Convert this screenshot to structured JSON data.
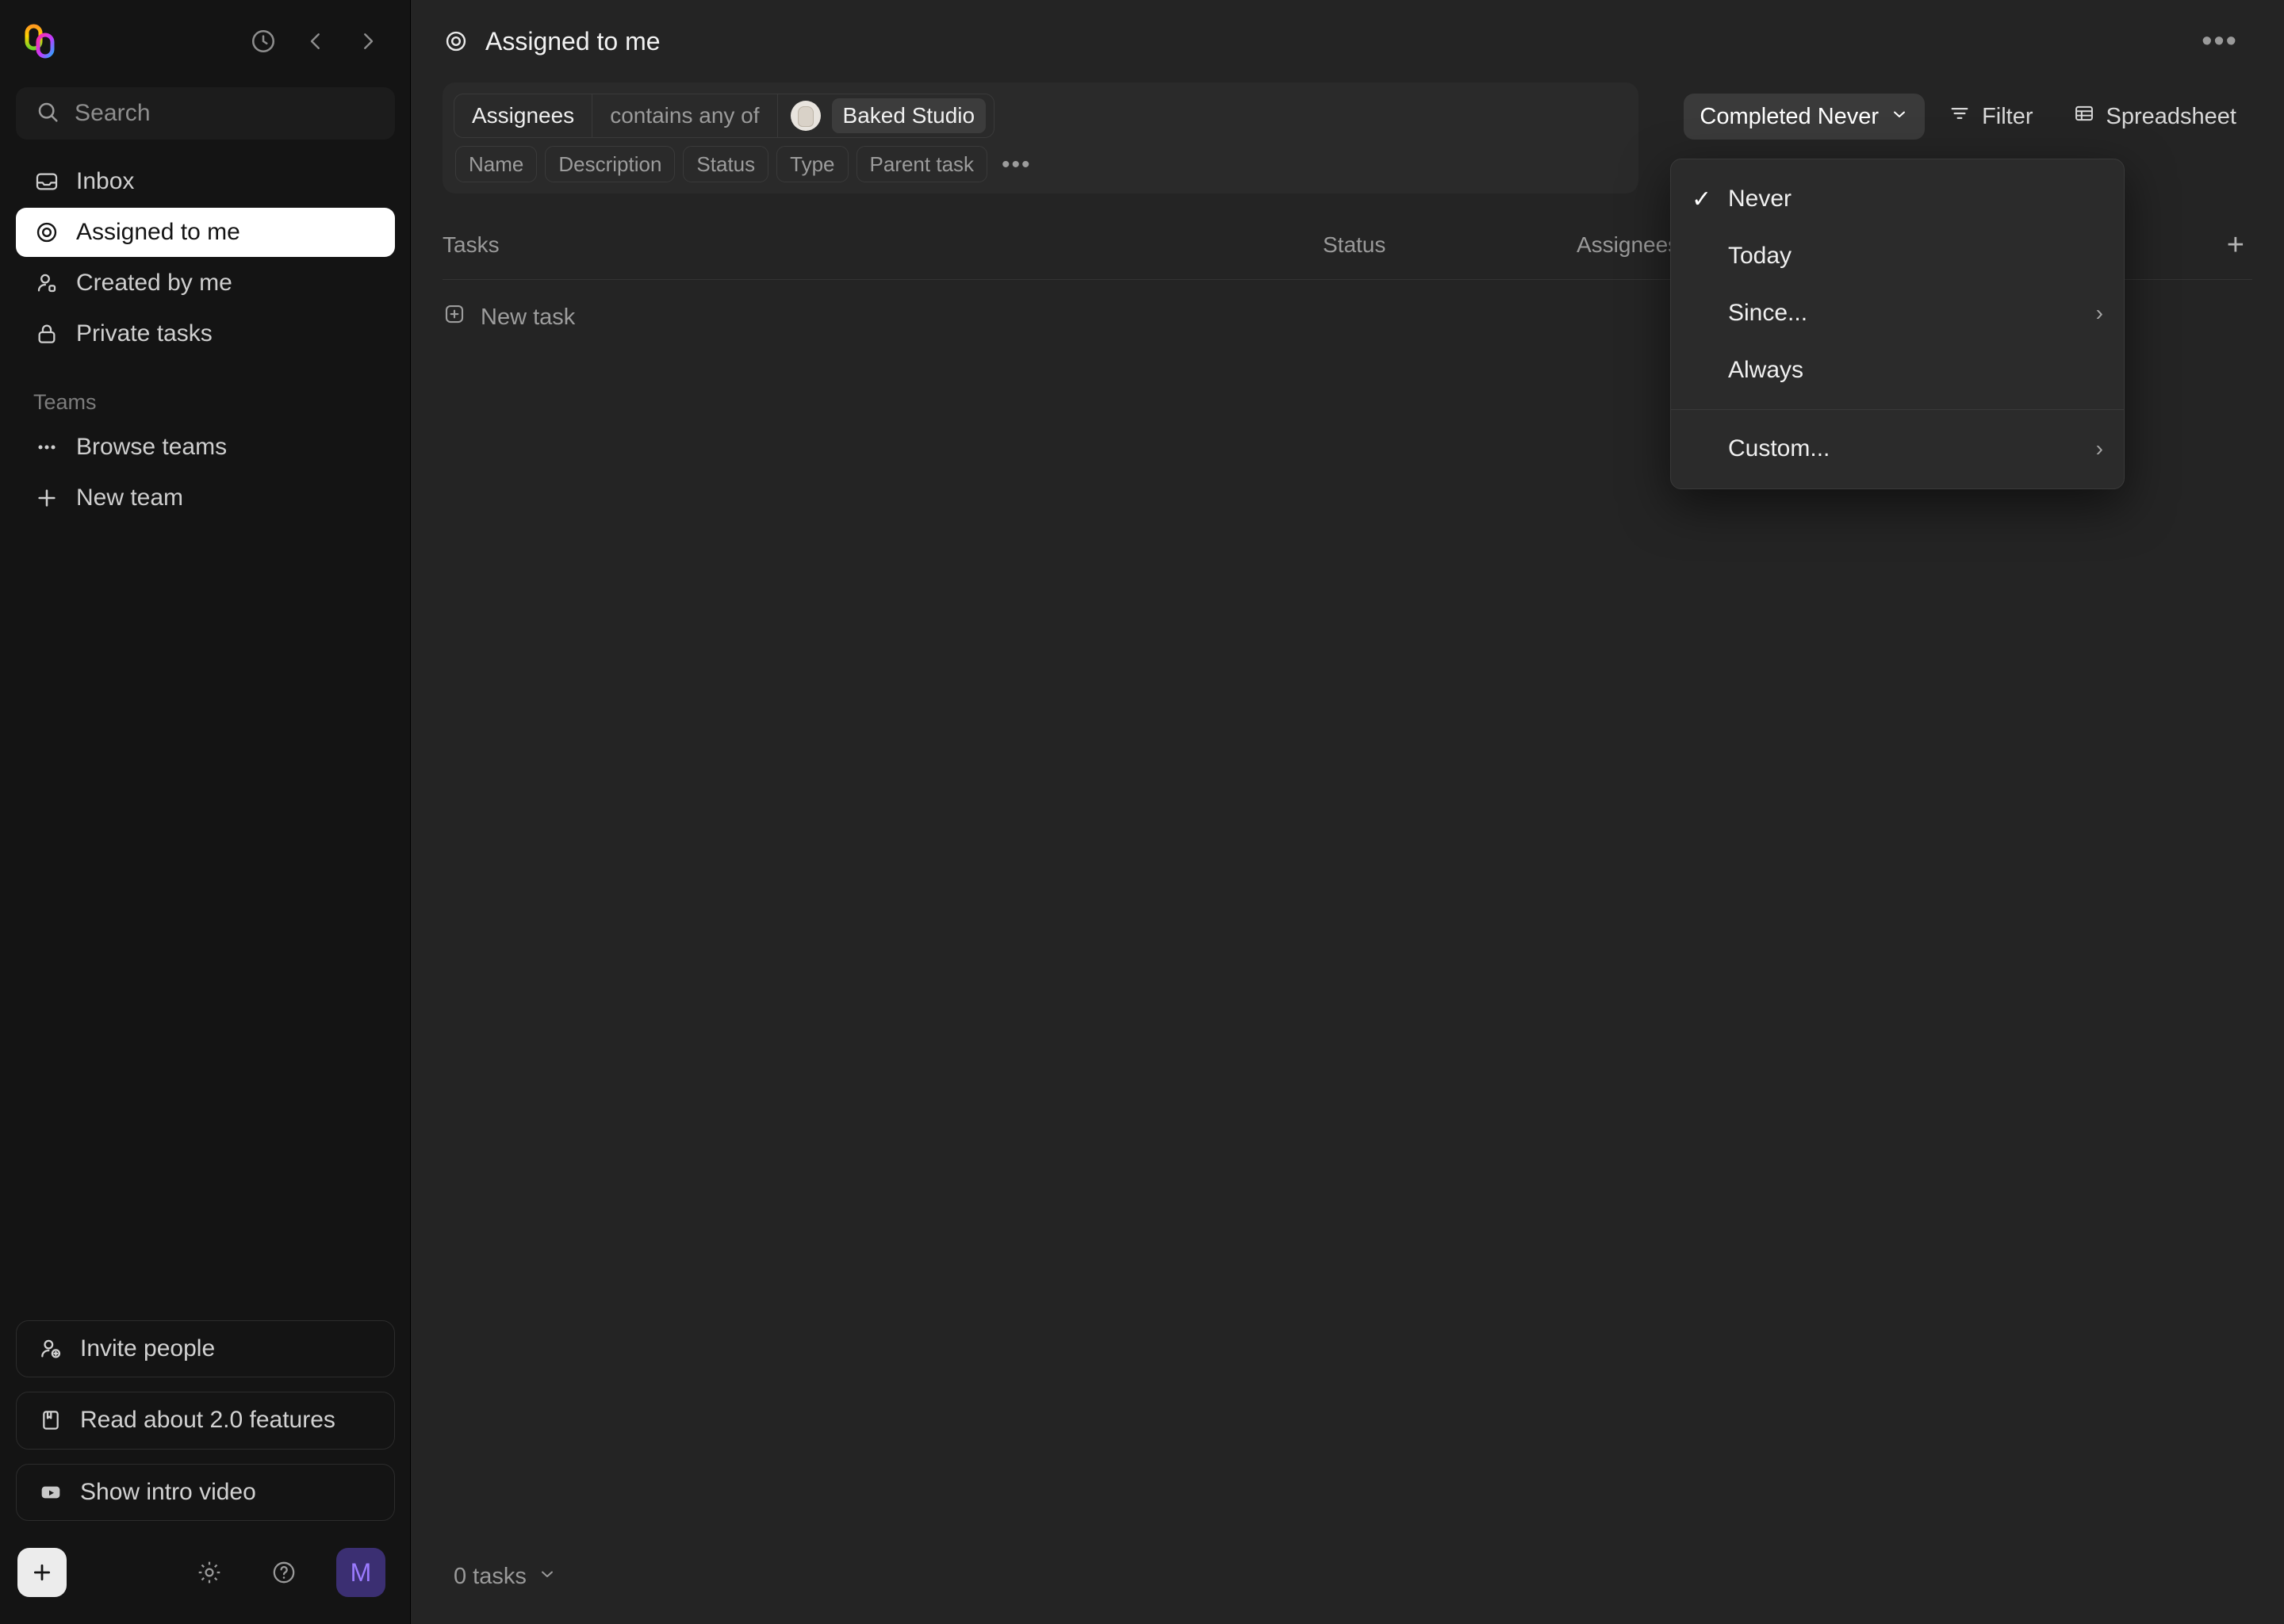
{
  "app": {
    "logo_name": "height-logo",
    "accent_purple": "#9b7bff",
    "avatar_bg": "#3b2f72"
  },
  "sidebar": {
    "history_icon": "clock-icon",
    "back_icon": "chevron-left-icon",
    "forward_icon": "chevron-right-icon",
    "search": {
      "placeholder": "Search",
      "icon": "search-icon"
    },
    "nav_items": [
      {
        "label": "Inbox",
        "icon": "inbox-icon",
        "active": false
      },
      {
        "label": "Assigned to me",
        "icon": "target-icon",
        "active": true
      },
      {
        "label": "Created by me",
        "icon": "user-icon",
        "active": false
      },
      {
        "label": "Private tasks",
        "icon": "lock-icon",
        "active": false
      }
    ],
    "teams_section_label": "Teams",
    "team_items": [
      {
        "label": "Browse teams",
        "icon": "ellipsis-icon"
      },
      {
        "label": "New team",
        "icon": "plus-icon"
      }
    ],
    "cards": [
      {
        "label": "Invite people",
        "icon": "user-plus-icon"
      },
      {
        "label": "Read about 2.0 features",
        "icon": "book-icon"
      },
      {
        "label": "Show intro video",
        "icon": "video-play-icon"
      }
    ],
    "bottom": {
      "new_label": "+",
      "settings_icon": "gear-icon",
      "help_icon": "question-circle-icon",
      "avatar_initial": "M"
    }
  },
  "header": {
    "title": "Assigned to me",
    "title_icon": "target-icon",
    "more_label": "•••"
  },
  "filters": {
    "pill": {
      "field": "Assignees",
      "operator": "contains any of",
      "value": "Baked Studio",
      "avatar_name": "baked-studio-avatar"
    },
    "chips": [
      "Name",
      "Description",
      "Status",
      "Type",
      "Parent task"
    ],
    "chips_more": "•••"
  },
  "toolbar": {
    "completed_label": "Completed Never",
    "completed_caret": "⌄",
    "filter_label": "Filter",
    "filter_icon": "filter-icon",
    "spreadsheet_label": "Spreadsheet",
    "spreadsheet_icon": "table-icon"
  },
  "dropdown": {
    "items": [
      {
        "label": "Never",
        "checked": true,
        "submenu": false
      },
      {
        "label": "Today",
        "checked": false,
        "submenu": false
      },
      {
        "label": "Since...",
        "checked": false,
        "submenu": true
      },
      {
        "label": "Always",
        "checked": false,
        "submenu": false
      }
    ],
    "custom": {
      "label": "Custom...",
      "submenu": true
    },
    "check_glyph": "✓",
    "arrow_glyph": "›"
  },
  "table": {
    "columns": [
      "Tasks",
      "Status",
      "Assignees"
    ],
    "add_column_label": "+",
    "new_task_label": "New task",
    "new_task_icon": "plus-square-icon",
    "rows": []
  },
  "footer": {
    "count_label": "0 tasks",
    "caret": "⌄"
  }
}
